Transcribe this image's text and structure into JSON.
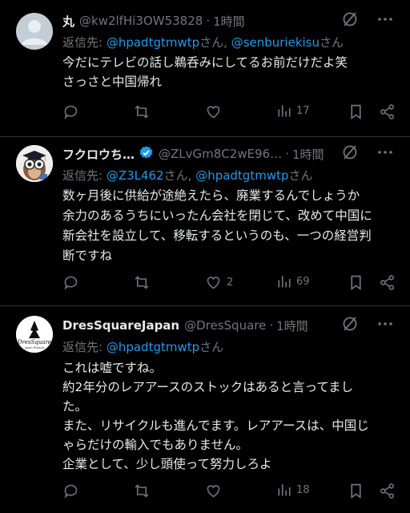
{
  "posts": [
    {
      "name": "丸",
      "handle": "@kw2lfHi3OW53828",
      "sep": "·",
      "time": "1時間",
      "reply_prefix": "返信先: ",
      "reply_to": [
        "@hpadtgtmwtp",
        "@senburiekisu"
      ],
      "reply_joiner": "さん, ",
      "reply_suffix": "さん",
      "lines": [
        "今だにテレビの話し鵜呑みにしてるお前だけだよ笑",
        "さっさと中国帰れ"
      ],
      "views": "17",
      "likes": ""
    },
    {
      "name": "フクロウち…",
      "handle": "@ZLvGm8C2wE96…",
      "sep": "·",
      "time": "1時間",
      "reply_prefix": "返信先: ",
      "reply_to": [
        "@Z3L462",
        "@hpadtgtmwtp"
      ],
      "reply_joiner": "さん, ",
      "reply_suffix": "さん",
      "lines": [
        "数ヶ月後に供給が途絶えたら、廃業するんでしょうか",
        "余力のあるうちにいったん会社を閉じて、改めて中国に",
        "新会社を設立して、移転するというのも、一つの経営判",
        "断ですね"
      ],
      "views": "69",
      "likes": "2"
    },
    {
      "name": "DresSquareJapan",
      "handle": "@DresSquare",
      "sep": "·",
      "time": "1時間",
      "reply_prefix": "返信先: ",
      "reply_to": [
        "@hpadtgtmwtp"
      ],
      "reply_joiner": "",
      "reply_suffix": "さん",
      "lines": [
        "これは嘘ですね。",
        "約2年分のレアアースのストックはあると言ってまし",
        "た。",
        "また、リサイクルも進んでます。レアアースは、中国じ",
        "ゃらだけの輸入でもありません。",
        "企業として、少し頭使って努力しろよ"
      ],
      "views": "18",
      "likes": "",
      "avatar_logo_text": "DresSquare",
      "avatar_logo_sub": "Japan Product"
    }
  ],
  "colors": {
    "bg": "#000000",
    "text": "#e7e9ea",
    "muted": "#71767b",
    "link": "#1d9bf0",
    "divider": "#2f3336"
  },
  "icons": [
    "default-avatar-icon",
    "owl-avatar-icon",
    "dress-logo-avatar",
    "verified-badge-icon",
    "grok-slash-icon",
    "more-icon",
    "reply-icon",
    "repost-icon",
    "like-icon",
    "views-icon",
    "bookmark-icon",
    "share-icon"
  ]
}
